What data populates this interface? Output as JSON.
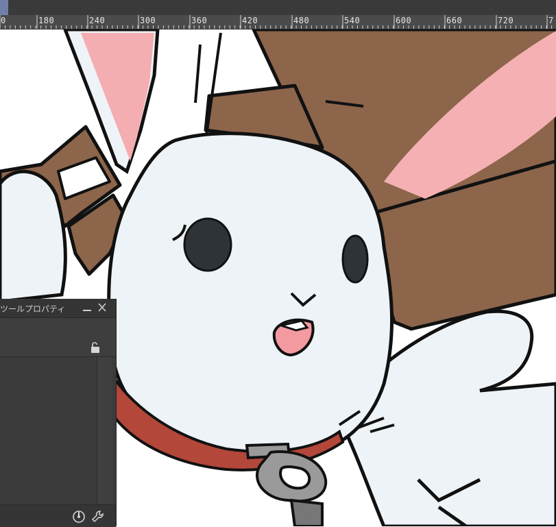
{
  "ruler": {
    "labels": [
      "0",
      "180",
      "240",
      "300",
      "360",
      "420",
      "480",
      "540",
      "600",
      "660",
      "720",
      "7"
    ]
  },
  "panel": {
    "title": "ツールプロパティ",
    "minimize_icon": "minimize-icon",
    "close_icon": "close-icon",
    "lock_icon": "unlock-icon",
    "mode_buttons": [
      {
        "name": "add-selection-mode",
        "icon": "circle-plus-icon",
        "active": true
      },
      {
        "name": "subtract-selection-mode",
        "icon": "circle-minus-icon",
        "active": false
      }
    ],
    "reference_buttons": [
      {
        "name": "reference-all",
        "icon": "lasso-search-icon",
        "active": true
      },
      {
        "name": "reference-rect",
        "icon": "rect-search-icon",
        "active": false
      },
      {
        "name": "reference-exclude",
        "icon": "lasso-x-icon",
        "active": false
      }
    ],
    "footer_icons": [
      "settings-dial-icon",
      "wrench-icon"
    ]
  },
  "colors": {
    "fur": "#eef3f7",
    "ear_pink": "#f4adb0",
    "wood": "#8c654b",
    "collar": "#b3473a",
    "ring": "#9a9a9a",
    "line": "#111111",
    "accent": "#6d7fb0"
  }
}
